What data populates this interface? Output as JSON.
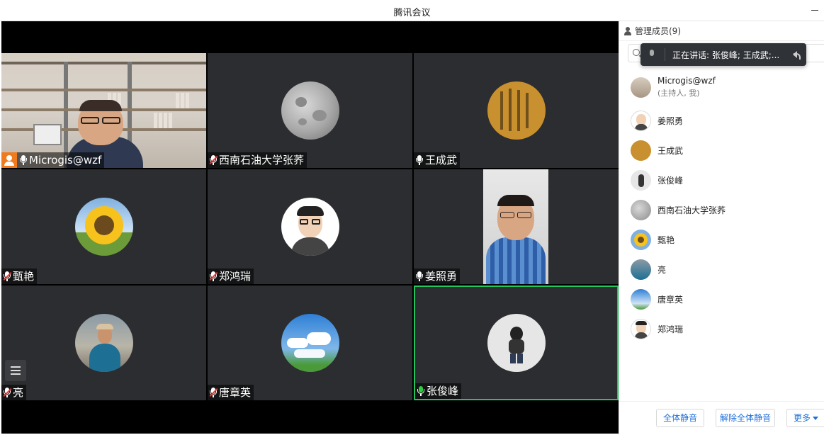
{
  "window": {
    "title": "腾讯会议"
  },
  "tiles": [
    {
      "name": "Microgis@wzf",
      "mic": "on",
      "host": true
    },
    {
      "name": "西南石油大学张荞",
      "mic": "muted"
    },
    {
      "name": "王成武",
      "mic": "on"
    },
    {
      "name": "甄艳",
      "mic": "muted"
    },
    {
      "name": "郑鸿瑞",
      "mic": "muted"
    },
    {
      "name": "姜照勇",
      "mic": "on"
    },
    {
      "name": "亮",
      "mic": "muted"
    },
    {
      "name": "唐章英",
      "mic": "muted"
    },
    {
      "name": "张俊峰",
      "mic": "active",
      "speaking": true
    }
  ],
  "panel": {
    "header": "管理成员(9)",
    "toast": "正在讲话: 张俊峰; 王成武;...",
    "members": [
      {
        "name": "Microgis@wzf",
        "sub": "(主持人, 我)"
      },
      {
        "name": "姜照勇"
      },
      {
        "name": "王成武"
      },
      {
        "name": "张俊峰"
      },
      {
        "name": "西南石油大学张荞"
      },
      {
        "name": "甄艳"
      },
      {
        "name": "亮"
      },
      {
        "name": "唐章英"
      },
      {
        "name": "郑鸿瑞"
      }
    ],
    "buttons": {
      "mute_all": "全体静音",
      "unmute_all": "解除全体静音",
      "more": "更多"
    }
  },
  "colors": {
    "speaking_border": "#22c55e",
    "host_badge": "#f07b1f",
    "link": "#1e6fd9"
  }
}
